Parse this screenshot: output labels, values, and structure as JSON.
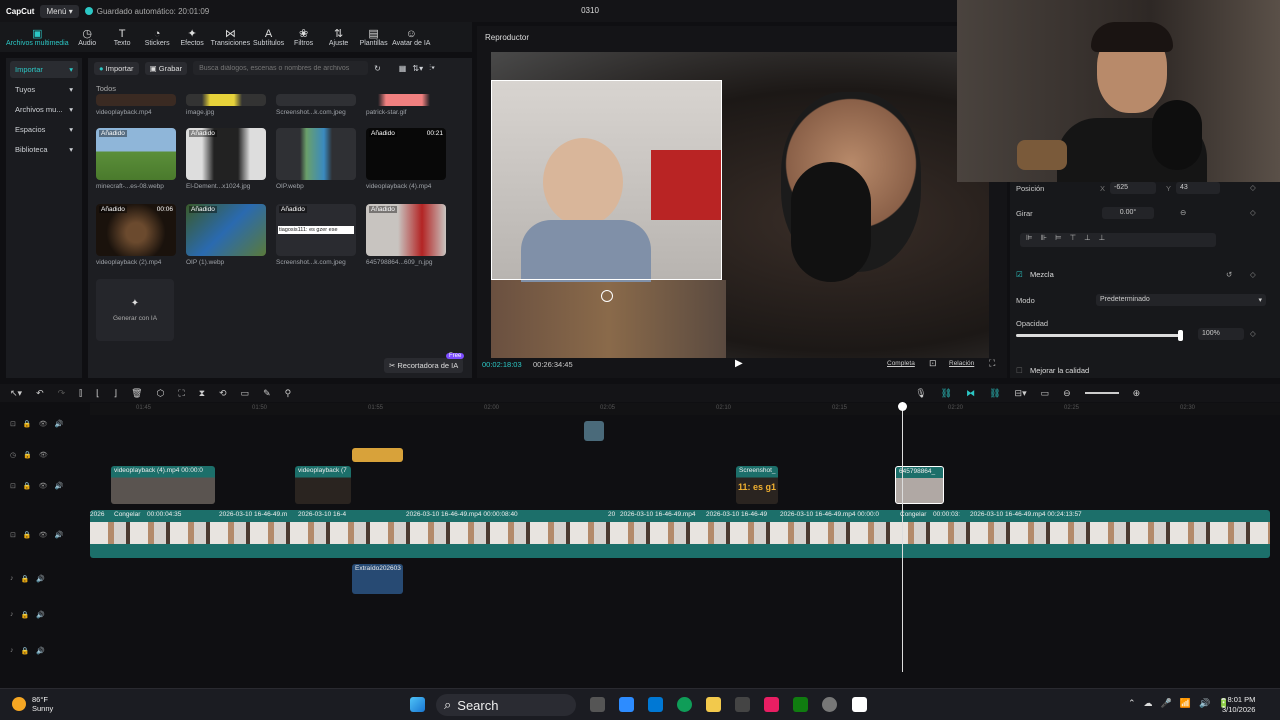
{
  "app": {
    "brand": "CapCut",
    "menu_label": "Menú",
    "autosave": "Guardado automático: 20:01:09",
    "project_title": "0310"
  },
  "tools": [
    {
      "label": "Archivos multimedia",
      "icon": "media-icon",
      "glyph": "▣"
    },
    {
      "label": "Audio",
      "icon": "audio-icon",
      "glyph": "◷"
    },
    {
      "label": "Texto",
      "icon": "text-icon",
      "glyph": "T"
    },
    {
      "label": "Stickers",
      "icon": "sticker-icon",
      "glyph": "◔"
    },
    {
      "label": "Efectos",
      "icon": "effects-icon",
      "glyph": "✦"
    },
    {
      "label": "Transiciones",
      "icon": "transition-icon",
      "glyph": "⋈"
    },
    {
      "label": "Subtítulos",
      "icon": "subtitles-icon",
      "glyph": "A"
    },
    {
      "label": "Filtros",
      "icon": "filter-icon",
      "glyph": "❀"
    },
    {
      "label": "Ajuste",
      "icon": "adjust-icon",
      "glyph": "⇅"
    },
    {
      "label": "Plantillas",
      "icon": "template-icon",
      "glyph": "▤"
    },
    {
      "label": "Avatar de IA",
      "icon": "avatar-icon",
      "glyph": "☺"
    }
  ],
  "leftnav": [
    "Importar",
    "Tuyos",
    "Archivos mu...",
    "Espacios",
    "Biblioteca"
  ],
  "media": {
    "import_label": "Importar",
    "record_label": "Grabar",
    "search_placeholder": "Busca diálogos, escenas o nombres de archivos",
    "todos": "Todos",
    "generate_label": "Generar con IA",
    "recortadora_label": "Recortadora de IA",
    "free_badge": "Free",
    "added_label": "Añadido",
    "row0": [
      "videoplayback.mp4",
      "image.jpg",
      "Screenshot...k.com.jpeg",
      "patrick-star.gif"
    ],
    "row1": [
      {
        "name": "minecraft-...es-08.webp",
        "added": true,
        "dur": ""
      },
      {
        "name": "El-Dement...x1024.jpg",
        "added": true,
        "dur": ""
      },
      {
        "name": "OIP.webp",
        "added": false,
        "dur": ""
      },
      {
        "name": "videoplayback (4).mp4",
        "added": true,
        "dur": "00:21"
      }
    ],
    "row2": [
      {
        "name": "videoplayback (2).mp4",
        "added": true,
        "dur": "00:06"
      },
      {
        "name": "OIP (1).webp",
        "added": true,
        "dur": ""
      },
      {
        "name": "Screenshot...k.com.jpeg",
        "added": true,
        "dur": ""
      },
      {
        "name": "645798864...609_n.jpg",
        "added": true,
        "dur": ""
      }
    ],
    "screenshot_text": "tiagosis111: es gzer ese"
  },
  "player": {
    "title": "Reproductor",
    "current_time": "00:02:18:03",
    "total_time": "00:26:34:45",
    "complete_label": "Completa",
    "ratio_label": "Relación"
  },
  "props": {
    "position_label": "Posición",
    "x_label": "X",
    "x_value": "-625",
    "y_label": "Y",
    "y_value": "43",
    "rotate_label": "Girar",
    "rotate_value": "0.00°",
    "blend_label": "Mezcla",
    "mode_label": "Modo",
    "mode_value": "Predeterminado",
    "opacity_label": "Opacidad",
    "opacity_value": "100%",
    "opacity_level": 1.0,
    "quality_label": "Mejorar la calidad"
  },
  "ruler_ticks": [
    "01:45",
    "01:50",
    "01:55",
    "02:00",
    "02:05",
    "02:10",
    "02:15",
    "02:20",
    "02:25",
    "02:30"
  ],
  "clips": {
    "c1": "videoplayback (4).mp4  00:00:0",
    "c2": "videoplayback (7",
    "c3": "Screenshot_",
    "c3b": "11: es g1",
    "c4": "645798864_",
    "main": [
      "2026",
      "Congelar",
      "00:00:04:35",
      "2026-03-10 16-46-49.m",
      "2026-03-10 16-4",
      "2026-03-10 16-46-49.mp4  00:00:08:40",
      "20",
      "2026-03-10 16-46-49.mp4",
      "2026-03-10 16-46-49",
      "2026-03-10 16-46-49.mp4  00:00:0",
      "Congelar",
      "00:00:03:",
      "2026-03-10 16-46-49.mp4  00:24:13:57"
    ],
    "audio": "Extraído202603"
  },
  "taskbar": {
    "temp": "86°F",
    "weather": "Sunny",
    "search": "Search",
    "time": "8:01 PM",
    "date": "3/10/2026"
  },
  "colors": {
    "accent": "#2cc7c5",
    "clip_teal": "#1c6f6a",
    "text_clip": "#d8a23a",
    "audio_clip": "#274a73"
  }
}
